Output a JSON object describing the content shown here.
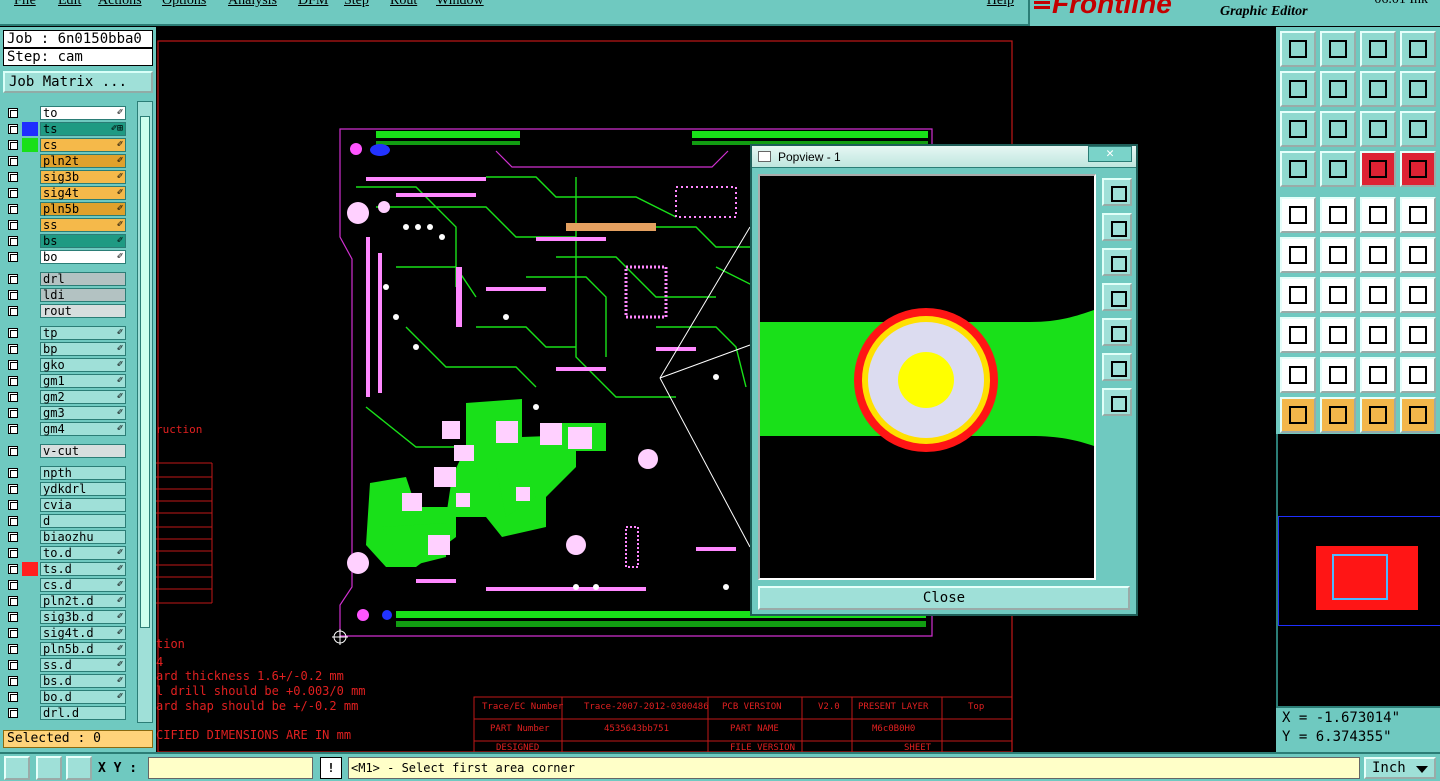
{
  "menubar": {
    "items": [
      "File",
      "Edit",
      "Actions",
      "Options",
      "Analysis",
      "DFM",
      "Step",
      "Rout",
      "Window"
    ],
    "help": "Help"
  },
  "brand": {
    "logo": "Frontline",
    "subtitle": "Graphic Editor",
    "version": "06.01 Ink"
  },
  "job": {
    "job_line": "Job : 6n0150bba0",
    "step_line": "Step: cam",
    "matrix_button": "Job Matrix ..."
  },
  "layers": [
    {
      "name": "to",
      "swatch": "",
      "color": "#ffffff",
      "icon": "✐"
    },
    {
      "name": "ts",
      "swatch": "#1f2fff",
      "color": "#1f9a83",
      "icon": "✐⊞"
    },
    {
      "name": "cs",
      "swatch": "#19e019",
      "color": "#f5b94a",
      "icon": "✐"
    },
    {
      "name": "pln2t",
      "swatch": "",
      "color": "#e0a12b",
      "icon": "✐"
    },
    {
      "name": "sig3b",
      "swatch": "",
      "color": "#f5b94a",
      "icon": "✐"
    },
    {
      "name": "sig4t",
      "swatch": "",
      "color": "#f5b94a",
      "icon": "✐"
    },
    {
      "name": "pln5b",
      "swatch": "",
      "color": "#e0a12b",
      "icon": "✐"
    },
    {
      "name": "ss",
      "swatch": "",
      "color": "#f5b94a",
      "icon": "✐"
    },
    {
      "name": "bs",
      "swatch": "",
      "color": "#1f9a83",
      "icon": "✐"
    },
    {
      "name": "bo",
      "swatch": "",
      "color": "#ffffff",
      "icon": "✐"
    },
    {
      "name": "drl",
      "swatch": "",
      "color": "#b3c2c2",
      "icon": ""
    },
    {
      "name": "ldi",
      "swatch": "",
      "color": "#b3c2c2",
      "icon": ""
    },
    {
      "name": "rout",
      "swatch": "",
      "color": "#d7dede",
      "icon": ""
    },
    {
      "name": "tp",
      "swatch": "",
      "color": "#9fe0d8",
      "icon": "✐"
    },
    {
      "name": "bp",
      "swatch": "",
      "color": "#9fe0d8",
      "icon": "✐"
    },
    {
      "name": "gko",
      "swatch": "",
      "color": "#9fe0d8",
      "icon": "✐"
    },
    {
      "name": "gm1",
      "swatch": "",
      "color": "#9fe0d8",
      "icon": "✐"
    },
    {
      "name": "gm2",
      "swatch": "",
      "color": "#9fe0d8",
      "icon": "✐"
    },
    {
      "name": "gm3",
      "swatch": "",
      "color": "#9fe0d8",
      "icon": "✐"
    },
    {
      "name": "gm4",
      "swatch": "",
      "color": "#9fe0d8",
      "icon": "✐"
    },
    {
      "name": "v-cut",
      "swatch": "",
      "color": "#d7dede",
      "icon": ""
    },
    {
      "name": "npth",
      "swatch": "",
      "color": "#9fe0d8",
      "icon": ""
    },
    {
      "name": "ydkdrl",
      "swatch": "",
      "color": "#9fe0d8",
      "icon": ""
    },
    {
      "name": "cvia",
      "swatch": "",
      "color": "#9fe0d8",
      "icon": ""
    },
    {
      "name": "d",
      "swatch": "",
      "color": "#9fe0d8",
      "icon": ""
    },
    {
      "name": "biaozhu",
      "swatch": "",
      "color": "#9fe0d8",
      "icon": ""
    },
    {
      "name": "to.d",
      "swatch": "",
      "color": "#9fe0d8",
      "icon": "✐"
    },
    {
      "name": "ts.d",
      "swatch": "#ff2020",
      "color": "#9fe0d8",
      "icon": "✐"
    },
    {
      "name": "cs.d",
      "swatch": "",
      "color": "#9fe0d8",
      "icon": "✐"
    },
    {
      "name": "pln2t.d",
      "swatch": "",
      "color": "#9fe0d8",
      "icon": "✐"
    },
    {
      "name": "sig3b.d",
      "swatch": "",
      "color": "#9fe0d8",
      "icon": "✐"
    },
    {
      "name": "sig4t.d",
      "swatch": "",
      "color": "#9fe0d8",
      "icon": "✐"
    },
    {
      "name": "pln5b.d",
      "swatch": "",
      "color": "#9fe0d8",
      "icon": "✐"
    },
    {
      "name": "ss.d",
      "swatch": "",
      "color": "#9fe0d8",
      "icon": "✐"
    },
    {
      "name": "bs.d",
      "swatch": "",
      "color": "#9fe0d8",
      "icon": "✐"
    },
    {
      "name": "bo.d",
      "swatch": "",
      "color": "#9fe0d8",
      "icon": "✐"
    },
    {
      "name": "drl.d",
      "swatch": "",
      "color": "#9fe0d8",
      "icon": ""
    }
  ],
  "selected": "Selected : 0",
  "popview": {
    "title": "Popview - 1",
    "close_label": "Close"
  },
  "canvas_notes": {
    "n1": "ruction",
    "n2": "tion",
    "n3": "4",
    "n4": "ard thickness 1.6+/-0.2 mm",
    "n5": "l drill should be +0.003/0 mm",
    "n6": "ard shap should be +/-0.2 mm",
    "n7": "CIFIED DIMENSIONS ARE IN mm"
  },
  "title_block": {
    "c1": "Trace/EC Number",
    "c2": "Trace-2007-2012-0300486",
    "c3": "PCB VERSION",
    "c4": "V2.0",
    "c5": "PRESENT LAYER",
    "c6": "Top",
    "c7": "PART Number",
    "c8": "4535643bb751",
    "c9": "PART NAME",
    "c10": "M6c0B0H0",
    "c11": "DESIGNED",
    "c12": "FILE VERSION",
    "c13": "SHEET"
  },
  "coords": {
    "x": "X = -1.673014\"",
    "y": "Y = 6.374355\""
  },
  "status": {
    "xy_label": "X Y :",
    "prompt": "<M1> - Select first area corner",
    "units": "Inch"
  },
  "colors": {
    "panel": "#6fc9c0",
    "accent": "#9fe0d8",
    "trace": "#19e019",
    "pad": "#ff55ff",
    "outline": "#d030d0"
  }
}
